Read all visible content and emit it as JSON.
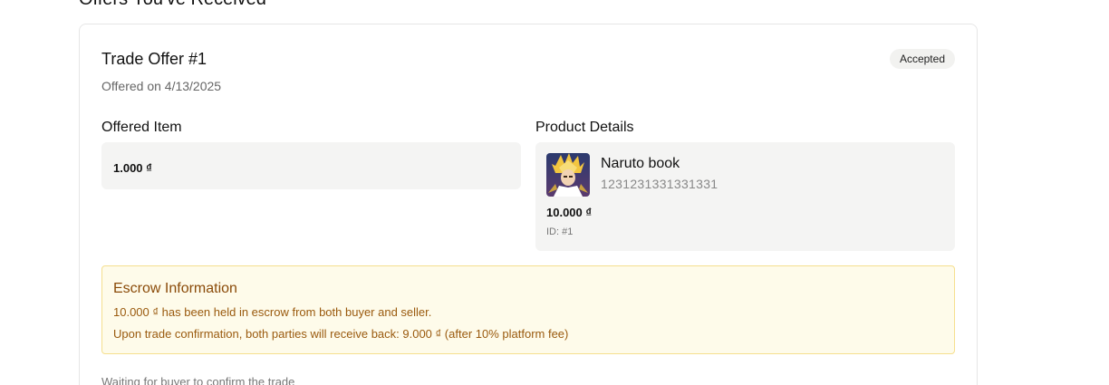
{
  "section": {
    "heading": "Offers You've Received"
  },
  "offer": {
    "title": "Trade Offer #1",
    "date_text": "Offered on 4/13/2025",
    "status": "Accepted",
    "offered_item": {
      "label": "Offered Item",
      "price": "1.000 ₫"
    },
    "product": {
      "label": "Product Details",
      "name": "Naruto book",
      "description": "1231231331331331",
      "price": "10.000 ₫",
      "id_text": "ID: #1",
      "image": "anime-character-thumbnail"
    },
    "escrow": {
      "title": "Escrow Information",
      "line1": "10.000 ₫ has been held in escrow from both buyer and seller.",
      "line2": "Upon trade confirmation, both parties will receive back: 9.000 ₫ (after 10% platform fee)"
    },
    "waiting_text": "Waiting for buyer to confirm the trade"
  },
  "colors": {
    "escrow_bg": "#fefbea",
    "escrow_border": "#f5df8e",
    "escrow_text": "#9a5a0e",
    "box_bg": "#f4f4f3"
  }
}
